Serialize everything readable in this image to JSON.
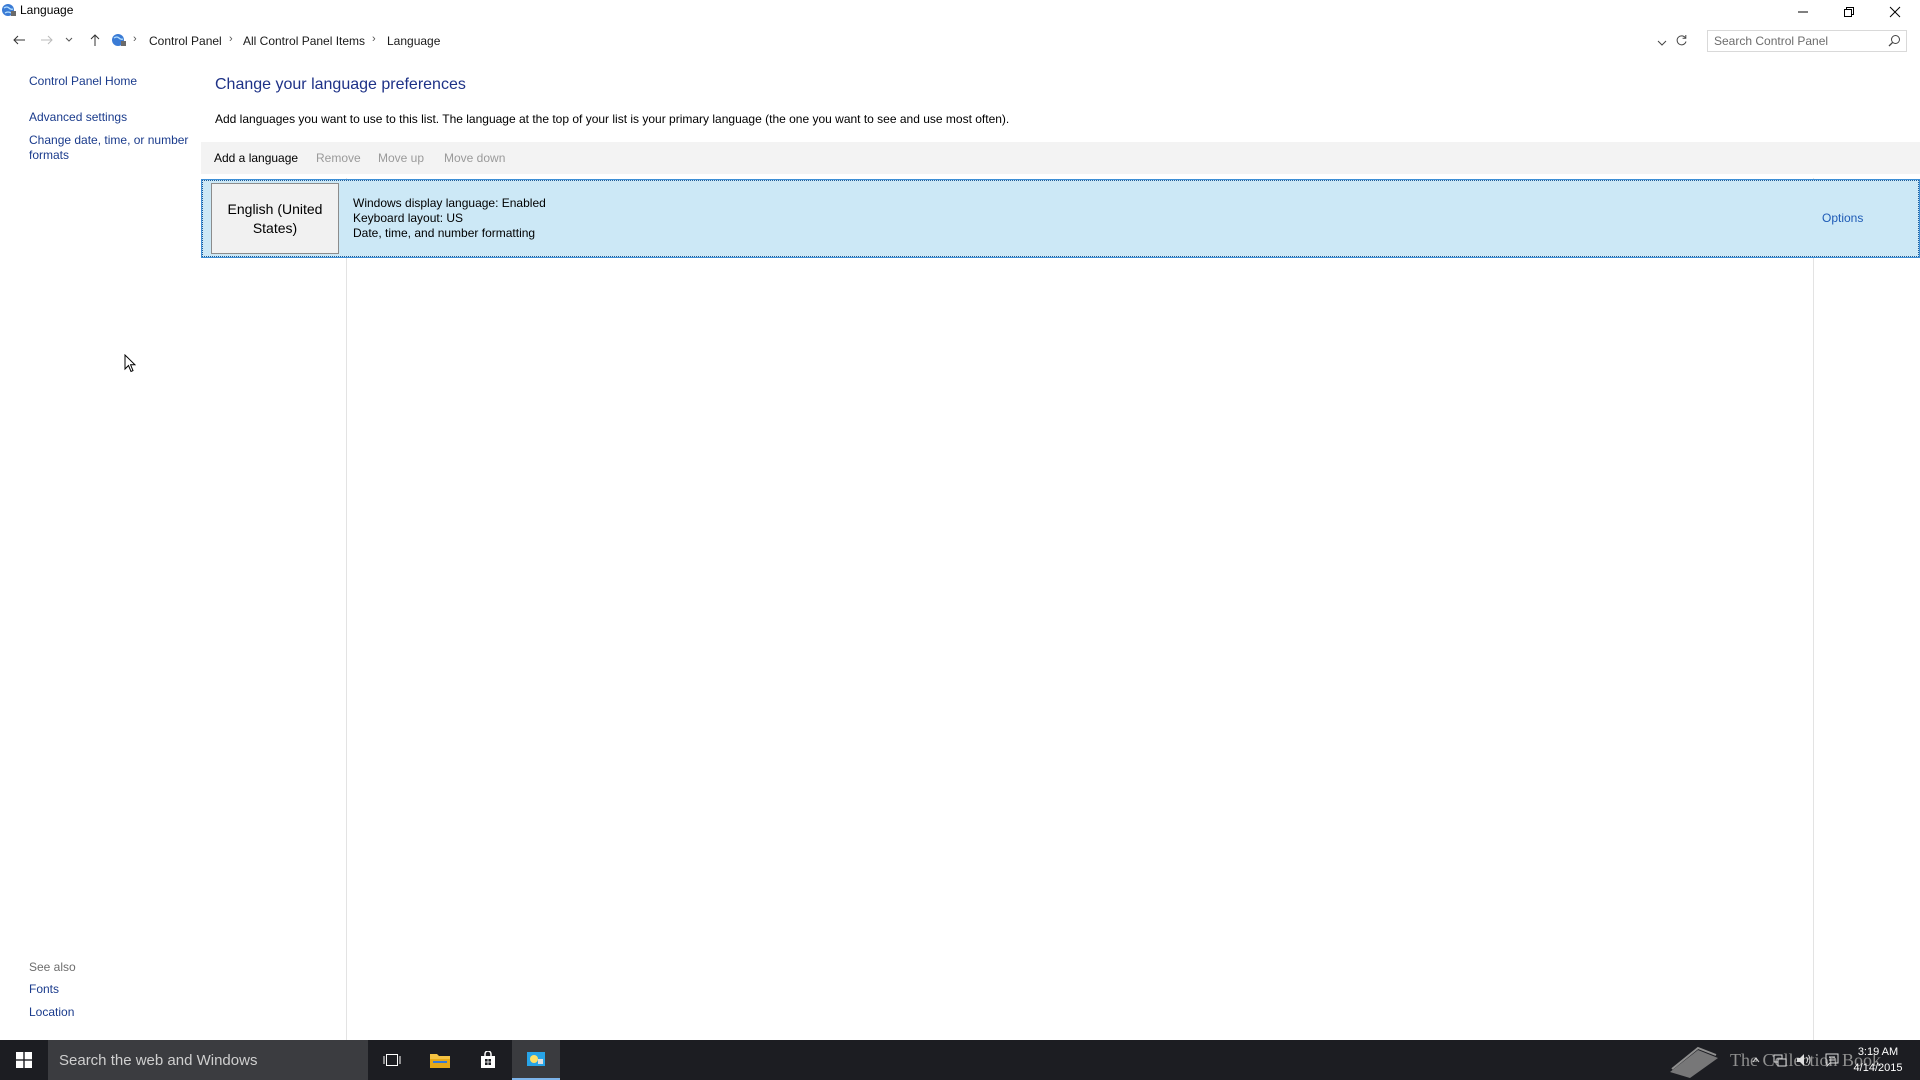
{
  "window": {
    "title": "Language"
  },
  "address": {
    "crumbs": [
      "Control Panel",
      "All Control Panel Items",
      "Language"
    ]
  },
  "search": {
    "placeholder": "Search Control Panel"
  },
  "left_pane": {
    "home": "Control Panel Home",
    "links": [
      "Advanced settings",
      "Change date, time, or number formats"
    ],
    "see_also_title": "See also",
    "see_also": [
      "Fonts",
      "Location"
    ]
  },
  "main": {
    "title": "Change your language preferences",
    "description": "Add languages you want to use to this list. The language at the top of your list is your primary language (the one you want to see and use most often).",
    "toolbar": {
      "add": "Add a language",
      "remove": "Remove",
      "move_up": "Move up",
      "move_down": "Move down"
    },
    "languages": [
      {
        "name": "English (United States)",
        "details": [
          "Windows display language: Enabled",
          "Keyboard layout: US",
          "Date, time, and number formatting"
        ],
        "options": "Options"
      }
    ]
  },
  "taskbar": {
    "search_text": "Search the web and Windows",
    "watermark": "The Collection Book",
    "clock_time": "3:19 AM",
    "clock_date": "4/14/2015"
  },
  "colors": {
    "selection_bg": "#cce8f6",
    "selection_border": "#3d8fd6",
    "link": "#1a3b8c",
    "title": "#1e3287",
    "taskbar": "#1c1d22"
  },
  "icons": {
    "app": "control-panel-globe-icon",
    "back": "arrow-left-icon",
    "forward": "arrow-right-icon",
    "recent": "chevron-down-icon",
    "up": "arrow-up-icon",
    "refresh": "refresh-icon",
    "search": "search-icon",
    "minimize": "minimize-icon",
    "maximize": "restore-icon",
    "close": "close-icon"
  }
}
